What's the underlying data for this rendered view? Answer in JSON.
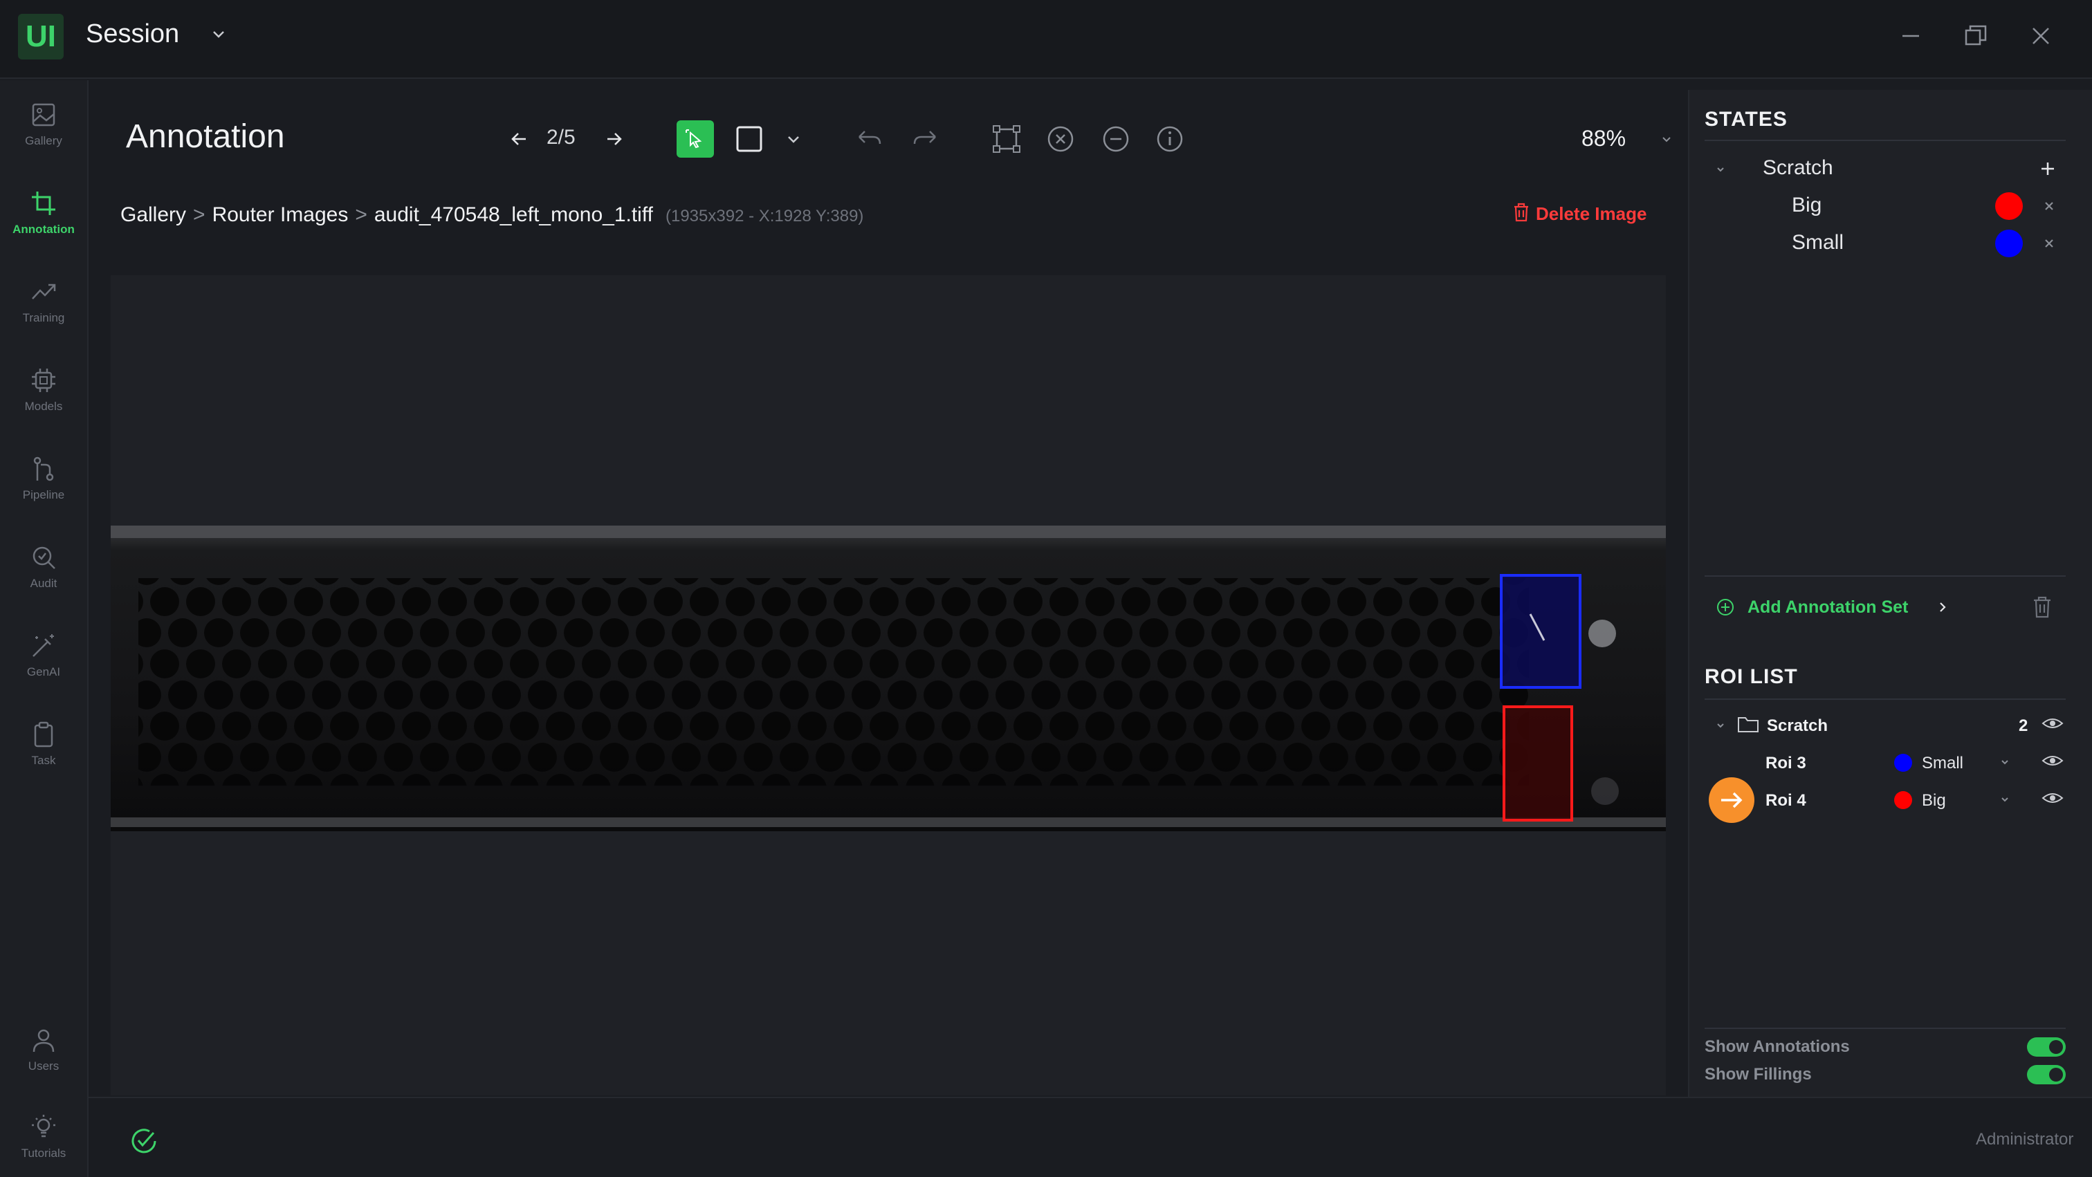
{
  "app": {
    "logo": "UI",
    "session_title": "Session"
  },
  "sidebar": {
    "items": [
      {
        "label": "Gallery",
        "icon": "image-icon"
      },
      {
        "label": "Annotation",
        "icon": "crop-icon",
        "active": true
      },
      {
        "label": "Training",
        "icon": "trend-icon"
      },
      {
        "label": "Models",
        "icon": "chip-icon"
      },
      {
        "label": "Pipeline",
        "icon": "git-branch-icon"
      },
      {
        "label": "Audit",
        "icon": "magnifier-icon"
      },
      {
        "label": "GenAI",
        "icon": "wand-icon"
      },
      {
        "label": "Task",
        "icon": "clipboard-icon"
      },
      {
        "label": "Users",
        "icon": "user-icon"
      },
      {
        "label": "Tutorials",
        "icon": "bulb-icon"
      }
    ]
  },
  "main": {
    "title": "Annotation",
    "pager": "2/5",
    "zoom": "88%",
    "breadcrumb": {
      "gallery": "Gallery",
      "folder": "Router Images",
      "file": "audit_470548_left_mono_1.tiff",
      "meta": "(1935x392 - X:1928 Y:389)"
    },
    "delete_label": "Delete Image"
  },
  "states": {
    "title": "STATES",
    "group": "Scratch",
    "items": [
      {
        "name": "Big",
        "color": "#ff0000"
      },
      {
        "name": "Small",
        "color": "#0000ff"
      }
    ],
    "add_set_label": "Add Annotation Set"
  },
  "roi_list": {
    "title": "ROI LIST",
    "group": "Scratch",
    "count": "2",
    "items": [
      {
        "name": "Roi 3",
        "state": "Small",
        "color": "#0000ff"
      },
      {
        "name": "Roi 4",
        "state": "Big",
        "color": "#ff0000"
      }
    ]
  },
  "toggles": {
    "show_annotations": "Show Annotations",
    "show_fillings": "Show Fillings"
  },
  "footer": {
    "user": "Administrator"
  },
  "colors": {
    "accent": "#2bbf54",
    "danger": "#ff3b3b",
    "roi_active": "#f7902b"
  }
}
